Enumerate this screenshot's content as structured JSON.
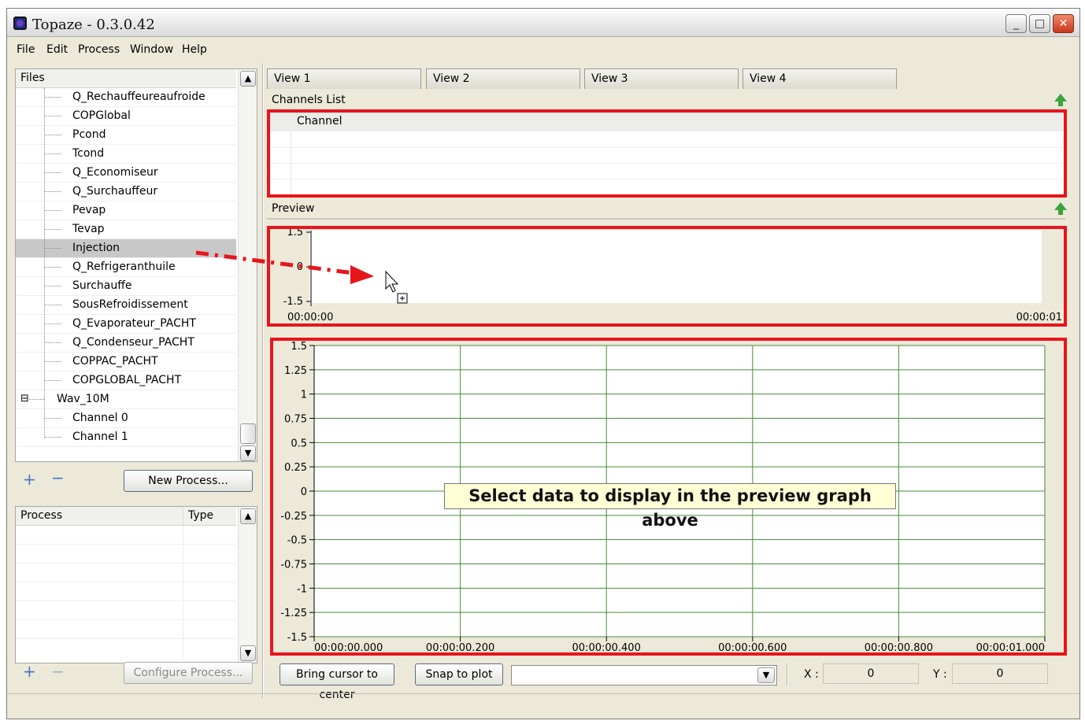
{
  "window": {
    "title": "Topaze - 0.3.0.42"
  },
  "title_buttons": {
    "minimize": "_",
    "maximize": "□",
    "close": "✕"
  },
  "menu": [
    "File",
    "Edit",
    "Process",
    "Window",
    "Help"
  ],
  "files_panel": {
    "header": "Files",
    "items": [
      {
        "label": "Q_Rechauffeureaufroide",
        "level": 2,
        "selected": false
      },
      {
        "label": "COPGlobal",
        "level": 2,
        "selected": false
      },
      {
        "label": "Pcond",
        "level": 2,
        "selected": false
      },
      {
        "label": "Tcond",
        "level": 2,
        "selected": false
      },
      {
        "label": "Q_Economiseur",
        "level": 2,
        "selected": false
      },
      {
        "label": "Q_Surchauffeur",
        "level": 2,
        "selected": false
      },
      {
        "label": "Pevap",
        "level": 2,
        "selected": false
      },
      {
        "label": "Tevap",
        "level": 2,
        "selected": false
      },
      {
        "label": "Injection",
        "level": 2,
        "selected": true
      },
      {
        "label": "Q_Refrigeranthuile",
        "level": 2,
        "selected": false
      },
      {
        "label": "Surchauffe",
        "level": 2,
        "selected": false
      },
      {
        "label": "SousRefroidissement",
        "level": 2,
        "selected": false
      },
      {
        "label": "Q_Evaporateur_PACHT",
        "level": 2,
        "selected": false
      },
      {
        "label": "Q_Condenseur_PACHT",
        "level": 2,
        "selected": false
      },
      {
        "label": "COPPAC_PACHT",
        "level": 2,
        "selected": false
      },
      {
        "label": "COPGLOBAL_PACHT",
        "level": 2,
        "selected": false
      },
      {
        "label": "Wav_10M",
        "level": 1,
        "selected": false,
        "expander": "⊟"
      },
      {
        "label": "Channel  0",
        "level": 2,
        "selected": false
      },
      {
        "label": "Channel  1",
        "level": 2,
        "selected": false
      }
    ],
    "add_icon": "+",
    "remove_icon": "−",
    "new_process_label": "New Process..."
  },
  "process_panel": {
    "columns": [
      "Process",
      "Type"
    ],
    "configure_label": "Configure Process..."
  },
  "tabs": [
    "View 1",
    "View 2",
    "View 3",
    "View 4"
  ],
  "channels_list": {
    "label": "Channels List",
    "column": "Channel"
  },
  "preview": {
    "label": "Preview",
    "y_ticks": [
      "1.5",
      "0",
      "-1.5"
    ],
    "x_start": "00:00:00",
    "x_end": "00:00:01"
  },
  "main_plot": {
    "y_ticks": [
      "1.5",
      "1.25",
      "1",
      "0.75",
      "0.5",
      "0.25",
      "0",
      "-0.25",
      "-0.5",
      "-0.75",
      "-1",
      "-1.25",
      "-1.5"
    ],
    "x_ticks": [
      "00:00:00.000",
      "00:00:00.200",
      "00:00:00.400",
      "00:00:00.600",
      "00:00:00.800",
      "00:00:01.000"
    ],
    "message": "Select data to display in the preview graph above"
  },
  "bottom_bar": {
    "bring_cursor_label": "Bring cursor to center",
    "snap_label": "Snap to plot",
    "combo_value": "",
    "x_label": "X :",
    "x_value": "0",
    "y_label": "Y :",
    "y_value": "0"
  },
  "colors": {
    "highlight_red": "#e8141c",
    "grid_green": "#4a8a3a",
    "accent_green": "#3da33d"
  }
}
